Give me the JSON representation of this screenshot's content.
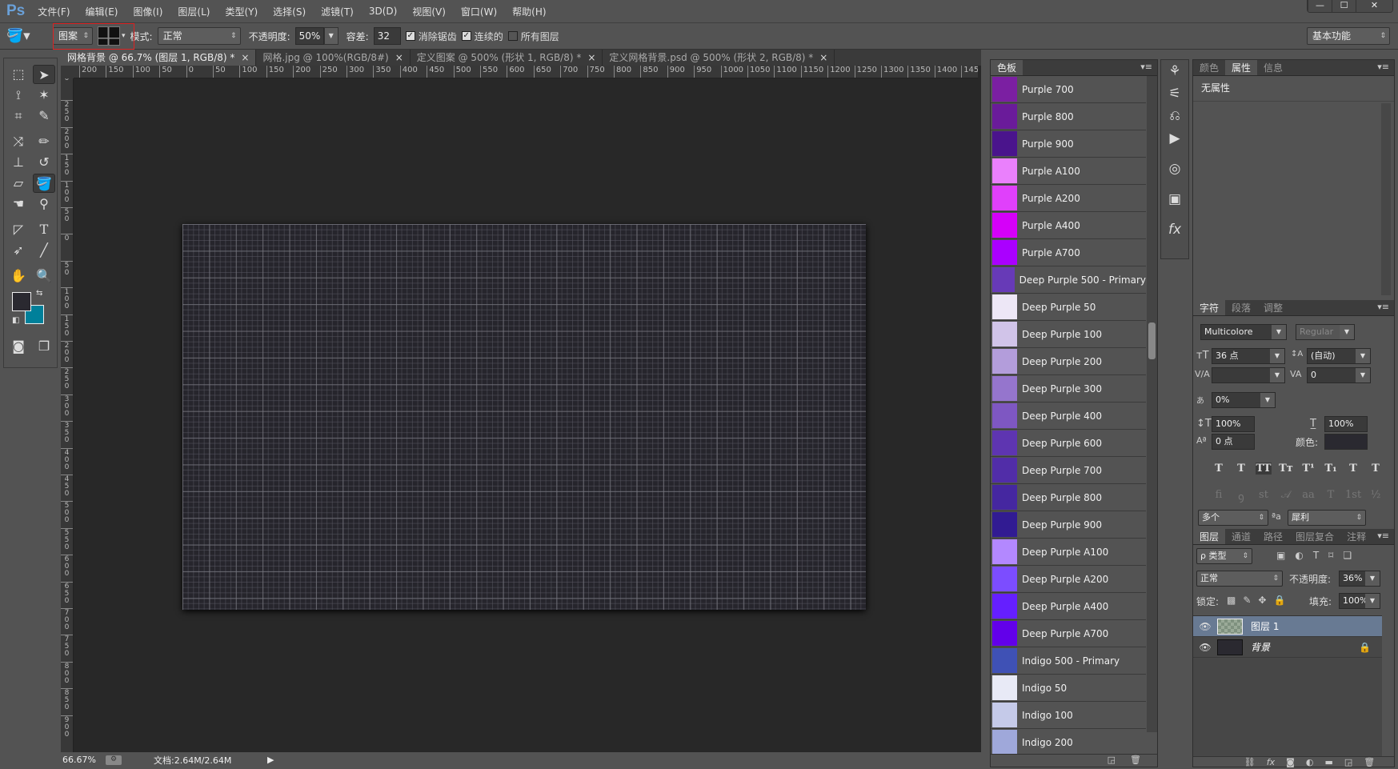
{
  "app": {
    "logo": "Ps",
    "menu": [
      "文件(F)",
      "编辑(E)",
      "图像(I)",
      "图层(L)",
      "类型(Y)",
      "选择(S)",
      "滤镜(T)",
      "3D(D)",
      "视图(V)",
      "窗口(W)",
      "帮助(H)"
    ],
    "window_controls": {
      "minimize": "—",
      "maximize": "☐",
      "close": "✕"
    }
  },
  "options": {
    "fill_source": "图案",
    "mode_label": "模式:",
    "mode_value": "正常",
    "opacity_label": "不透明度:",
    "opacity_value": "50%",
    "tolerance_label": "容差:",
    "tolerance_value": "32",
    "antialias": {
      "label": "消除锯齿",
      "checked": true
    },
    "contiguous": {
      "label": "连续的",
      "checked": true
    },
    "all_layers": {
      "label": "所有图层",
      "checked": false
    },
    "workspace": "基本功能"
  },
  "tabs": [
    {
      "label": "网格背景 @ 66.7% (图层 1, RGB/8) *",
      "active": true
    },
    {
      "label": "网格.jpg @ 100%(RGB/8#)",
      "active": false
    },
    {
      "label": "定义图案 @ 500% (形状 1, RGB/8) *",
      "active": false
    },
    {
      "label": "定义网格背景.psd @ 500% (形状 2, RGB/8) *",
      "active": false
    }
  ],
  "ruler_top": [
    "200",
    "150",
    "100",
    "50",
    "0",
    "50",
    "100",
    "150",
    "200",
    "250",
    "300",
    "350",
    "400",
    "450",
    "500",
    "550",
    "600",
    "650",
    "700",
    "750",
    "800",
    "850",
    "900",
    "950",
    "1000",
    "1050",
    "1100",
    "1150",
    "1200",
    "1250",
    "1300",
    "1350",
    "1400",
    "1450"
  ],
  "ruler_left": [
    "0",
    "250",
    "200",
    "150",
    "100",
    "50",
    "0",
    "50",
    "100",
    "150",
    "200",
    "250",
    "300",
    "350",
    "400",
    "450",
    "500",
    "550",
    "600",
    "650",
    "700",
    "750",
    "800",
    "850",
    "900"
  ],
  "colors": {
    "foreground": "#2a2930",
    "background": "#00809a",
    "canvas": "#26252c"
  },
  "status": {
    "zoom": "66.67%",
    "doc": "文档:2.64M/2.64M"
  },
  "swatches": {
    "tab": "色板",
    "items": [
      {
        "name": "Purple 700",
        "color": "#7B1FA2"
      },
      {
        "name": "Purple 800",
        "color": "#6A1B9A"
      },
      {
        "name": "Purple 900",
        "color": "#4A148C"
      },
      {
        "name": "Purple A100",
        "color": "#EA80FC"
      },
      {
        "name": "Purple A200",
        "color": "#E040FB"
      },
      {
        "name": "Purple A400",
        "color": "#D500F9"
      },
      {
        "name": "Purple A700",
        "color": "#AA00FF"
      },
      {
        "name": "Deep Purple 500 - Primary",
        "color": "#673AB7"
      },
      {
        "name": "Deep Purple 50",
        "color": "#EDE7F6"
      },
      {
        "name": "Deep Purple 100",
        "color": "#D1C4E9"
      },
      {
        "name": "Deep Purple 200",
        "color": "#B39DDB"
      },
      {
        "name": "Deep Purple 300",
        "color": "#9575CD"
      },
      {
        "name": "Deep Purple 400",
        "color": "#7E57C2"
      },
      {
        "name": "Deep Purple 600",
        "color": "#5E35B1"
      },
      {
        "name": "Deep Purple 700",
        "color": "#512DA8"
      },
      {
        "name": "Deep Purple 800",
        "color": "#4527A0"
      },
      {
        "name": "Deep Purple 900",
        "color": "#311B92"
      },
      {
        "name": "Deep Purple A100",
        "color": "#B388FF"
      },
      {
        "name": "Deep Purple A200",
        "color": "#7C4DFF"
      },
      {
        "name": "Deep Purple A400",
        "color": "#651FFF"
      },
      {
        "name": "Deep Purple A700",
        "color": "#6200EA"
      },
      {
        "name": "Indigo 500 - Primary",
        "color": "#3F51B5"
      },
      {
        "name": "Indigo 50",
        "color": "#E8EAF6"
      },
      {
        "name": "Indigo 100",
        "color": "#C5CAE9"
      },
      {
        "name": "Indigo 200",
        "color": "#9FA8DA"
      }
    ]
  },
  "properties": {
    "tabs": [
      "颜色",
      "属性",
      "信息"
    ],
    "active": 1,
    "content": "无属性"
  },
  "character": {
    "tabs": [
      "字符",
      "段落",
      "调整"
    ],
    "font_family": "Multicolore",
    "font_style": "Regular",
    "size": "36 点",
    "leading": "(自动)",
    "kerning": "",
    "tracking": "0",
    "tsume": "0%",
    "vscale": "100%",
    "hscale": "100%",
    "baseline": "0 点",
    "color_label": "颜色:",
    "language": "多个",
    "antialias_label": "ªa",
    "antialias": "犀利",
    "style_buttons": [
      "T",
      "T",
      "TT",
      "Tт",
      "T¹",
      "T₁",
      "T",
      "T"
    ],
    "opentype_buttons": [
      "ﬁ",
      "ꝯ",
      "st",
      "𝒜",
      "aa",
      "T",
      "1st",
      "½"
    ]
  },
  "layers": {
    "tabs": [
      "图层",
      "通道",
      "路径",
      "图层复合",
      "注释"
    ],
    "filter": "ρ 类型",
    "blend": "正常",
    "opacity_label": "不透明度:",
    "opacity": "36%",
    "lock_label": "锁定:",
    "fill_label": "填充:",
    "fill": "100%",
    "items": [
      {
        "name": "图层 1",
        "selected": true,
        "locked": false
      },
      {
        "name": "背景",
        "selected": false,
        "locked": true
      }
    ]
  }
}
